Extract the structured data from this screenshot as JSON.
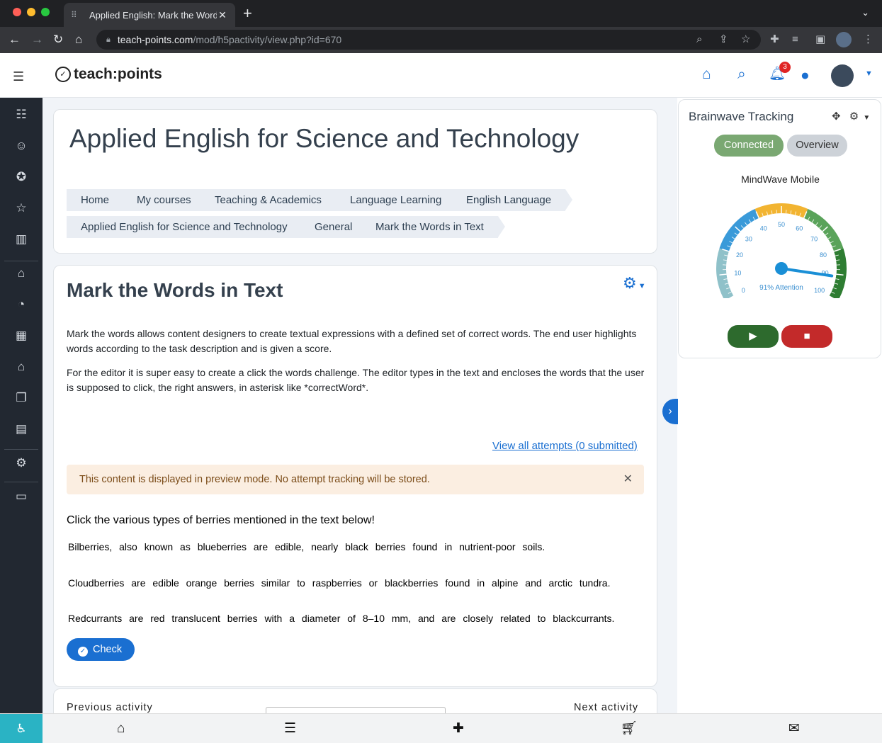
{
  "browser": {
    "tab_title": "Applied English: Mark the Words in Text",
    "url_host": "teach-points.com",
    "url_path": "/mod/h5pactivity/view.php?id=670"
  },
  "site": {
    "logo_text": "teach:points",
    "notification_count": "3"
  },
  "course": {
    "title": "Applied English for Science and Technology",
    "breadcrumbs": [
      "Home",
      "My courses",
      "Teaching & Academics",
      "Language Learning",
      "English Language",
      "Applied English for Science and Technology",
      "General",
      "Mark the Words in Text"
    ]
  },
  "activity": {
    "title": "Mark the Words in Text",
    "description_1": "Mark the words allows content designers to create textual expressions with a defined set of correct words. The end user highlights words according to the task description and is given a score.",
    "description_2": "For the editor it is super easy to create a click the words challenge. The editor types in the text and encloses the words that the user is supposed to click, the right answers, in asterisk like *correctWord*.",
    "attempts_link": "View all attempts (0 submitted)",
    "alert": "This content is displayed in preview mode. No attempt tracking will be stored.",
    "task": "Click the various types of berries mentioned in the text below!",
    "sentences": [
      "Bilberries, also known as blueberries are edible, nearly black berries found in nutrient-poor soils.",
      "Cloudberries are edible orange berries similar to raspberries or blackberries found in alpine and arctic tundra.",
      "Redcurrants are red translucent berries with a diameter of 8–10 mm, and are closely related to blackcurrants."
    ],
    "check_label": "Check",
    "prev_label": "Previous activity",
    "next_label": "Next activity"
  },
  "brainwave": {
    "title": "Brainwave Tracking",
    "tab_connected": "Connected",
    "tab_overview": "Overview",
    "device": "MindWave Mobile",
    "attention_label": "91% Attention",
    "attention_value": 91,
    "gauge_ticks": [
      "0",
      "10",
      "20",
      "30",
      "40",
      "50",
      "60",
      "70",
      "80",
      "90",
      "100"
    ]
  },
  "colors": {
    "accent": "#1a6fd1",
    "sidebar_bg": "#222831",
    "connected": "#7aa872",
    "play": "#2d6a2d",
    "stop": "#c32a2a"
  }
}
